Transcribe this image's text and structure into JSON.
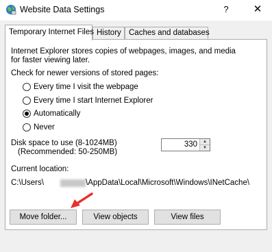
{
  "window": {
    "title": "Website Data Settings",
    "help_glyph": "?",
    "close_glyph": "✕"
  },
  "tabs": [
    {
      "label": "Temporary Internet Files",
      "active": true
    },
    {
      "label": "History",
      "active": false
    },
    {
      "label": "Caches and databases",
      "active": false
    }
  ],
  "panel": {
    "description_line1": "Internet Explorer stores copies of webpages, images, and media",
    "description_line2": "for faster viewing later.",
    "check_heading": "Check for newer versions of stored pages:",
    "radio_options": [
      {
        "label": "Every time I visit the webpage",
        "checked": false
      },
      {
        "label": "Every time I start Internet Explorer",
        "checked": false
      },
      {
        "label": "Automatically",
        "checked": true
      },
      {
        "label": "Never",
        "checked": false
      }
    ],
    "disk_space_label1": "Disk space to use (8-1024MB)",
    "disk_space_label2": "(Recommended: 50-250MB)",
    "disk_space_value": "330",
    "current_location_label": "Current location:",
    "path_prefix": "C:\\Users\\",
    "path_suffix": "\\AppData\\Local\\Microsoft\\Windows\\INetCache\\"
  },
  "buttons": {
    "move_folder": "Move folder...",
    "view_objects": "View objects",
    "view_files": "View files"
  },
  "colors": {
    "annotation_arrow": "#e8312f",
    "panel_bg": "#ffffff",
    "window_bg": "#f0f0f0"
  }
}
